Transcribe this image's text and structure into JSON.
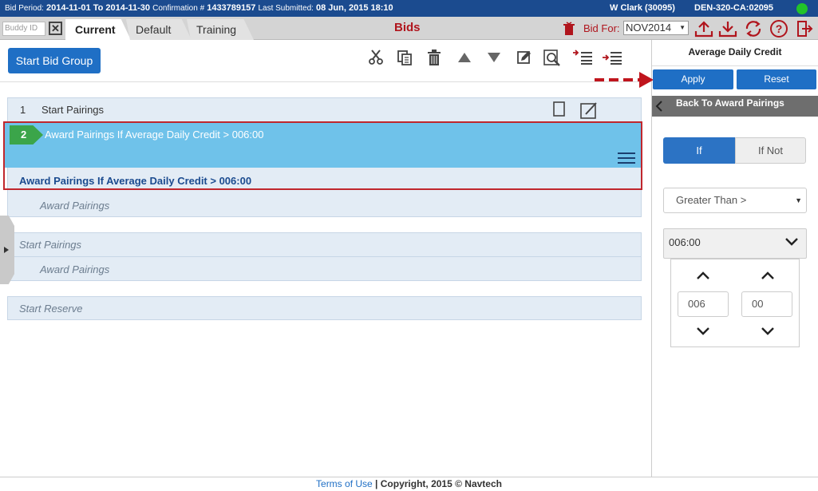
{
  "topbar": {
    "bid_period_label": "Bid Period:",
    "bid_period_value": "2014-11-01 To 2014-11-30",
    "confirmation_label": "Confirmation #",
    "confirmation_value": "1433789157",
    "last_submitted_label": "Last Submitted:",
    "last_submitted_value": "08 Jun, 2015 18:10",
    "user": "W Clark (30095)",
    "code": "DEN-320-CA:02095",
    "status_color": "#22c32a"
  },
  "tabbar": {
    "buddy_placeholder": "Buddy ID",
    "buddy_clear": "✕",
    "tabs": [
      "Current",
      "Default",
      "Training"
    ],
    "title": "Bids",
    "bid_for_label": "Bid For:",
    "bid_for_value": "NOV2014"
  },
  "toolbar": {
    "start_bid_group": "Start Bid Group"
  },
  "rows": {
    "row1_num": "1",
    "row1_label": "Start Pairings",
    "row2_num": "2",
    "row2_title": "Award Pairings If Average Daily Credit > 006:00",
    "row2_sub": "Award Pairings If Average Daily Credit > 006:00",
    "row3_label": "Award Pairings",
    "group2_label": "Start Pairings",
    "group2_sub": "Award Pairings",
    "group3_label": "Start Reserve"
  },
  "right_panel": {
    "title": "Average Daily Credit",
    "apply": "Apply",
    "reset": "Reset",
    "back": "Back To Award Pairings",
    "if": "If",
    "if_not": "If Not",
    "operator": "Greater Than >",
    "time_value": "006:00",
    "hours": "006",
    "minutes": "00"
  },
  "footer": {
    "terms": "Terms of Use",
    "separator": "|",
    "copyright": "Copyright, 2015 © Navtech"
  },
  "colors": {
    "header_blue": "#1b4b8f",
    "accent_blue": "#1f6fc5",
    "selected_row": "#6fc2ea",
    "badge_green": "#3ba54a",
    "highlight_red": "#c0272d"
  }
}
